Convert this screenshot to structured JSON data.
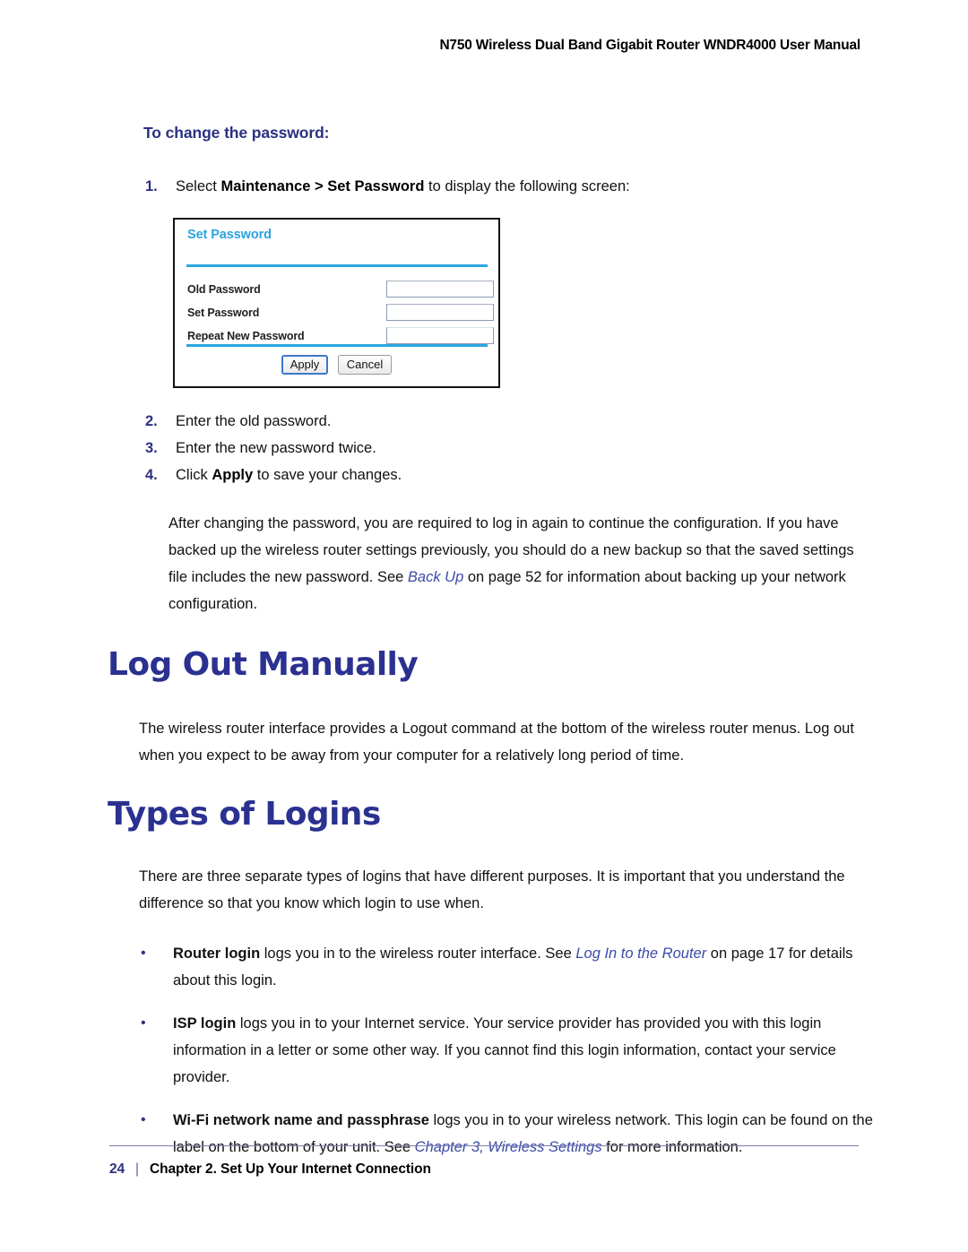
{
  "header": {
    "running_title": "N750 Wireless Dual Band Gigabit Router WNDR4000 User Manual"
  },
  "procedure": {
    "heading": "To change the password:",
    "steps": [
      {
        "number": "1.",
        "text_before": "Select ",
        "bold": "Maintenance > Set Password",
        "text_after": " to display the following screen:"
      },
      {
        "number": "2.",
        "text_before": "Enter the old password.",
        "bold": "",
        "text_after": ""
      },
      {
        "number": "3.",
        "text_before": "Enter the new password twice.",
        "bold": "",
        "text_after": ""
      },
      {
        "number": "4.",
        "text_before": "Click ",
        "bold": "Apply",
        "text_after": " to save your changes."
      }
    ],
    "note": {
      "part1": "After changing the password, you are required to log in again to continue the configuration. If you have backed up the wireless router settings previously, you should do a new backup so that the saved settings file includes the new password. See ",
      "xref": "Back Up",
      "part2": " on page 52 for information about backing up your network configuration."
    }
  },
  "screenshot": {
    "title": "Set Password",
    "fields": [
      {
        "label": "Old Password",
        "value": ""
      },
      {
        "label": "Set Password",
        "value": ""
      },
      {
        "label": "Repeat New Password",
        "value": ""
      }
    ],
    "apply_label": "Apply",
    "cancel_label": "Cancel",
    "accent_color": "#29a7e0",
    "title_color": "#2aa3dd"
  },
  "sections": [
    {
      "heading": "Log Out Manually",
      "paragraph": "The wireless router interface provides a Logout command at the bottom of the wireless router menus. Log out when you expect to be away from your computer for a relatively long period of time."
    },
    {
      "heading": "Types of Logins",
      "paragraph": "There are three separate types of logins that have different purposes. It is important that you understand the difference so that you know which login to use when."
    }
  ],
  "bullets": [
    {
      "marker": "•",
      "bold": "Router login",
      "text1": " logs you in to the wireless router interface. See ",
      "xref": "Log In to the Router",
      "text2": " on page 17 for details about this login."
    },
    {
      "marker": "•",
      "bold": "ISP login",
      "text1": " logs you in to your Internet service. Your service provider has provided you with this login information in a letter or some other way. If you cannot find this login information, contact your service provider.",
      "xref": "",
      "text2": ""
    },
    {
      "marker": "•",
      "bold": "Wi-Fi network name and passphrase",
      "text1": " logs you in to your wireless network. This login can be found on the label on the bottom of your unit. See ",
      "xref": "Chapter 3, Wireless Settings",
      "text2": " for more information."
    }
  ],
  "footer": {
    "page_number": "24",
    "separator": "|",
    "chapter": "Chapter 2. Set Up Your Internet Connection"
  },
  "colors": {
    "heading_blue": "#2b3190",
    "xref_blue": "#3b4ba8",
    "ui_accent": "#29a7e0"
  }
}
